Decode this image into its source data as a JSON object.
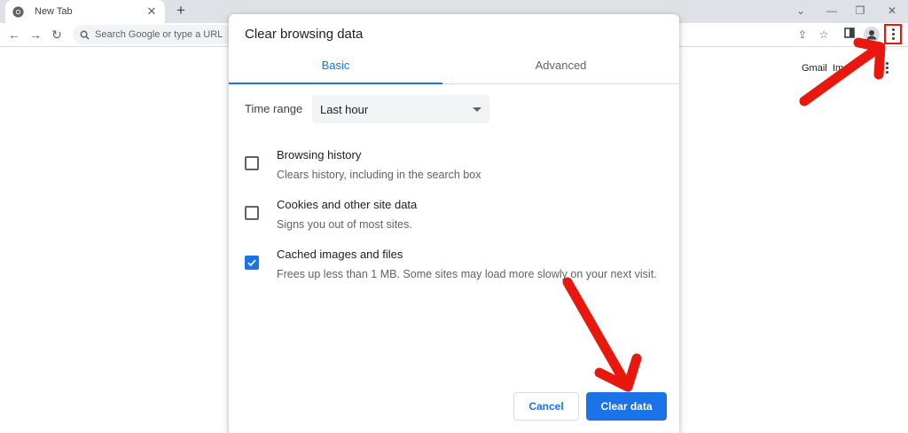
{
  "browser": {
    "tab_title": "New Tab",
    "tab_close": "✕",
    "newtab": "+",
    "omnibox_placeholder": "Search Google or type a URL",
    "links": {
      "gmail": "Gmail",
      "images": "Images"
    }
  },
  "dialog": {
    "title": "Clear browsing data",
    "tabs": [
      {
        "label": "Basic",
        "active": true
      },
      {
        "label": "Advanced",
        "active": false
      }
    ],
    "time_range": {
      "label": "Time range",
      "value": "Last hour"
    },
    "options": [
      {
        "title": "Browsing history",
        "desc": "Clears history, including in the search box",
        "checked": false
      },
      {
        "title": "Cookies and other site data",
        "desc": "Signs you out of most sites.",
        "checked": false
      },
      {
        "title": "Cached images and files",
        "desc": "Frees up less than 1 MB. Some sites may load more slowly on your next visit.",
        "checked": true
      }
    ],
    "buttons": {
      "cancel": "Cancel",
      "clear": "Clear data"
    }
  },
  "colors": {
    "accent": "#1a73e8",
    "annotation": "#e8180e",
    "chrome_bg": "#dee1e6"
  },
  "icons": {
    "tab_favicon": "chrome-icon",
    "back": "arrow-left-icon",
    "forward": "arrow-right-icon",
    "reload": "reload-icon",
    "search": "search-icon",
    "share": "share-icon",
    "bookmark": "star-icon",
    "side_panel": "side-panel-icon",
    "profile": "profile-icon",
    "menu": "kebab-menu-icon"
  }
}
